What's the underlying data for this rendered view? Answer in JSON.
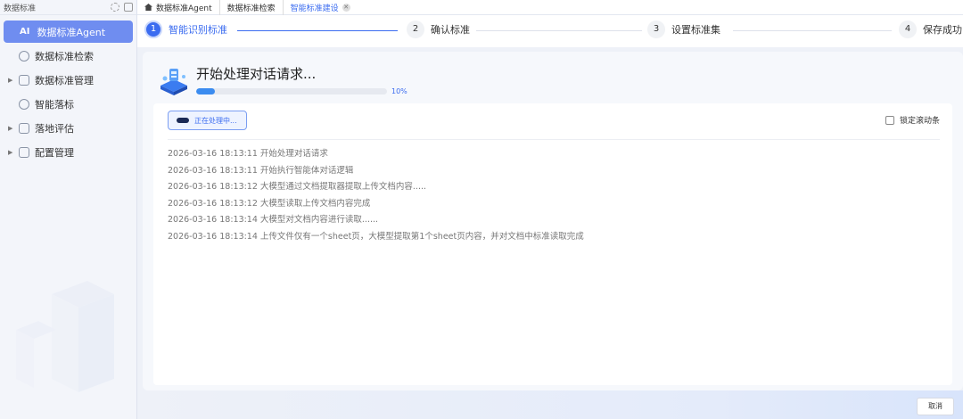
{
  "sidebar": {
    "title": "数据标准",
    "items": [
      {
        "label": "数据标准Agent",
        "active": true,
        "icon": "ai-icon"
      },
      {
        "label": "数据标准检索",
        "icon": "search-icon"
      },
      {
        "label": "数据标准管理",
        "icon": "manage-icon",
        "expandable": true
      },
      {
        "label": "智能落标",
        "icon": "smart-icon"
      },
      {
        "label": "落地评估",
        "icon": "evaluate-icon",
        "expandable": true
      },
      {
        "label": "配置管理",
        "icon": "config-icon",
        "expandable": true
      }
    ]
  },
  "tabs": [
    {
      "label": "数据标准Agent"
    },
    {
      "label": "数据标准检索"
    },
    {
      "label": "智能标准建设",
      "active": true
    }
  ],
  "steps": [
    {
      "num": "1",
      "label": "智能识别标准",
      "active": true
    },
    {
      "num": "2",
      "label": "确认标准"
    },
    {
      "num": "3",
      "label": "设置标准集"
    },
    {
      "num": "4",
      "label": "保存成功"
    }
  ],
  "progress": {
    "title": "开始处理对话请求...",
    "percent": 10,
    "percent_label": "10%"
  },
  "status": {
    "label": "正在处理中..."
  },
  "lock_scroll": {
    "label": "锁定滚动条",
    "checked": false
  },
  "logs": [
    "2026-03-16 18:13:11 开始处理对话请求",
    "2026-03-16 18:13:11 开始执行智能体对话逻辑",
    "2026-03-16 18:13:12 大模型通过文档提取器提取上传文档内容.....",
    "2026-03-16 18:13:12 大模型读取上传文档内容完成",
    "2026-03-16 18:13:14 大模型对文档内容进行读取......",
    "2026-03-16 18:13:14 上传文件仅有一个sheet页，大模型提取第1个sheet页内容，并对文档中标准读取完成"
  ],
  "footer": {
    "cancel_label": "取消"
  },
  "colors": {
    "accent": "#3b6cf0",
    "nav_active": "#6f8df0"
  }
}
